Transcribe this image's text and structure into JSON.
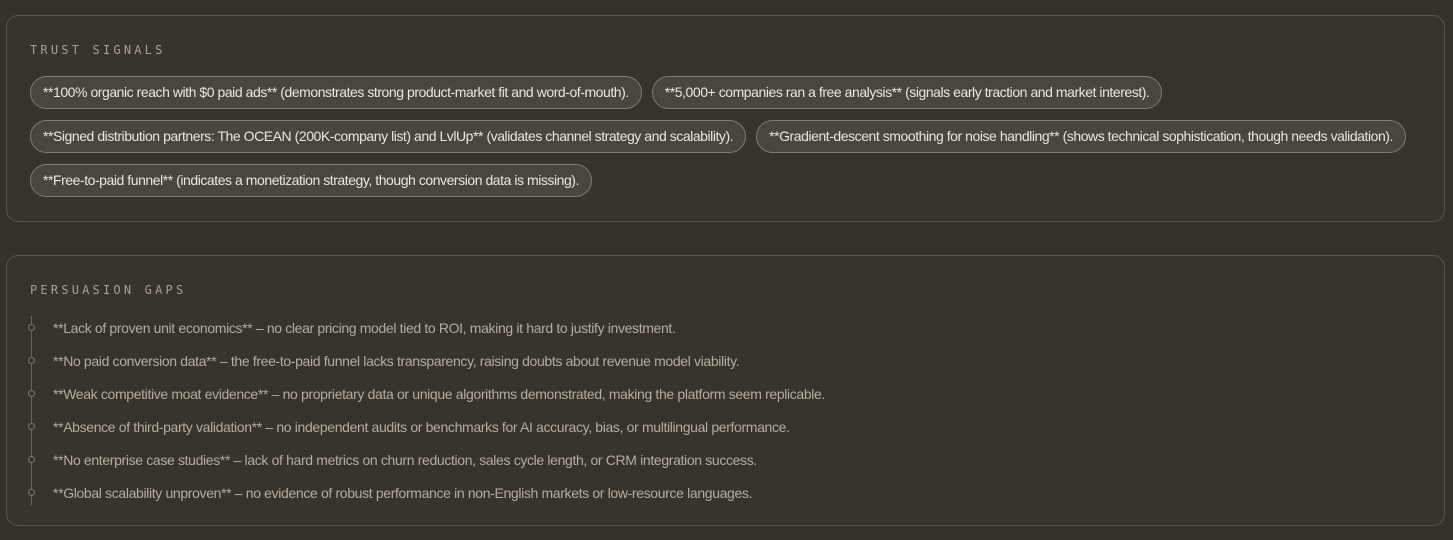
{
  "trust": {
    "title": "TRUST SIGNALS",
    "chips": [
      "**100% organic reach with $0 paid ads** (demonstrates strong product-market fit and word-of-mouth).",
      "**5,000+ companies ran a free analysis** (signals early traction and market interest).",
      "**Signed distribution partners: The OCEAN (200K-company list) and LvlUp** (validates channel strategy and scalability).",
      "**Gradient-descent smoothing for noise handling** (shows technical sophistication, though needs validation).",
      "**Free-to-paid funnel** (indicates a monetization strategy, though conversion data is missing)."
    ]
  },
  "gaps": {
    "title": "PERSUASION GAPS",
    "items": [
      "**Lack of proven unit economics** – no clear pricing model tied to ROI, making it hard to justify investment.",
      "**No paid conversion data** – the free-to-paid funnel lacks transparency, raising doubts about revenue model viability.",
      "**Weak competitive moat evidence** – no proprietary data or unique algorithms demonstrated, making the platform seem replicable.",
      "**Absence of third-party validation** – no independent audits or benchmarks for AI accuracy, bias, or multilingual performance.",
      "**No enterprise case studies** – lack of hard metrics on churn reduction, sales cycle length, or CRM integration success.",
      "**Global scalability unproven** – no evidence of robust performance in non-English markets or low-resource languages."
    ]
  },
  "colors": {
    "background": "#353129",
    "card_border": "#57524a",
    "chip_fill": "#4a463f",
    "chip_border": "#807a70",
    "chip_text": "#ebe6dc",
    "muted_text": "#b3aca1",
    "label_text": "#a79f93"
  }
}
